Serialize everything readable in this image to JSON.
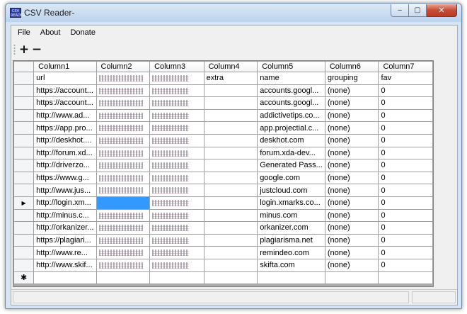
{
  "window": {
    "title": "CSV Reader-",
    "app_icon_text": "CSV\nREADER",
    "controls": {
      "minimize": "‒",
      "maximize": "▢",
      "close": "✕"
    }
  },
  "menu": [
    "File",
    "About",
    "Donate"
  ],
  "toolbar": {
    "add_label": "+",
    "remove_label": "−"
  },
  "grid": {
    "columns": [
      "Column1",
      "Column2",
      "Column3",
      "Column4",
      "Column5",
      "Column6",
      "Column7"
    ],
    "current_row_marker": "▶",
    "new_row_marker": "✱",
    "selection_color": "#3399ff",
    "rows": [
      [
        "url",
        "",
        "",
        "extra",
        "name",
        "grouping",
        "fav"
      ],
      [
        "https://account...",
        "",
        "",
        "",
        "accounts.googl...",
        "(none)",
        "0"
      ],
      [
        "https://account...",
        "",
        "",
        "",
        "accounts.googl...",
        "(none)",
        "0"
      ],
      [
        "http://www.ad...",
        "",
        "",
        "",
        "addictivetips.co...",
        "(none)",
        "0"
      ],
      [
        "https://app.pro...",
        "",
        "",
        "",
        "app.projectial.c...",
        "(none)",
        "0"
      ],
      [
        "http://deskhot....",
        "",
        "",
        "",
        "deskhot.com",
        "(none)",
        "0"
      ],
      [
        "http://forum.xd...",
        "",
        "",
        "",
        "forum.xda-dev...",
        "(none)",
        "0"
      ],
      [
        "http://driverzo...",
        "",
        "",
        "",
        "Generated Pass...",
        "(none)",
        "0"
      ],
      [
        "https://www.g...",
        "",
        "",
        "",
        "google.com",
        "(none)",
        "0"
      ],
      [
        "http://www.jus...",
        "",
        "",
        "",
        "justcloud.com",
        "(none)",
        "0"
      ],
      [
        "http://login.xm...",
        "",
        "",
        "",
        "login.xmarks.co...",
        "(none)",
        "0"
      ],
      [
        "http://minus.c...",
        "",
        "",
        "",
        "minus.com",
        "(none)",
        "0"
      ],
      [
        "http://orkanizer...",
        "",
        "",
        "",
        "orkanizer.com",
        "(none)",
        "0"
      ],
      [
        "https://plagiari...",
        "",
        "",
        "",
        "plagiarisma.net",
        "(none)",
        "0"
      ],
      [
        "http://www.re...",
        "",
        "",
        "",
        "remindeo.com",
        "(none)",
        "0"
      ],
      [
        "http://www.skif...",
        "",
        "",
        "",
        "skifta.com",
        "(none)",
        "0"
      ]
    ]
  }
}
